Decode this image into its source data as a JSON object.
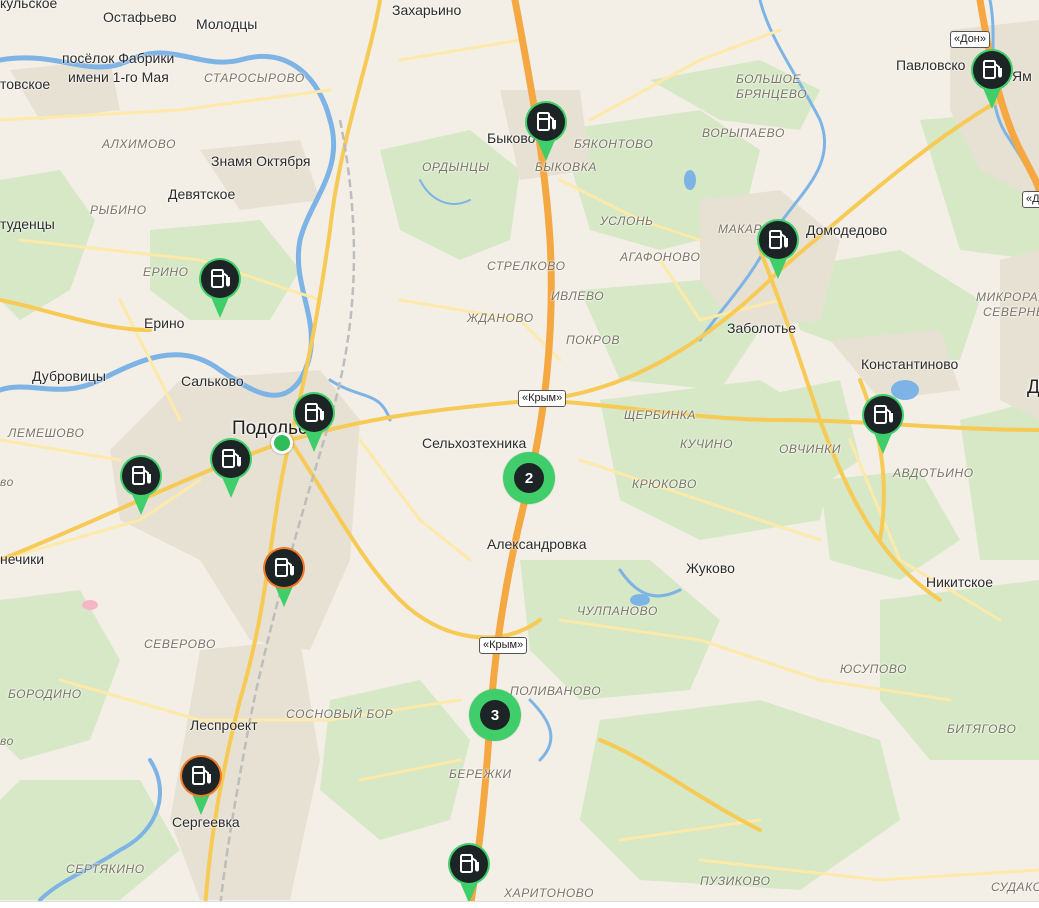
{
  "map": {
    "colors": {
      "background": "#f3efe6",
      "forest": "#d6e8c6",
      "built_up": "#e7e1d3",
      "water": "#7eb3e6",
      "road_minor": "#fde9a8",
      "road_major": "#f7c955",
      "road_highway": "#f5a742",
      "railway": "#bdbdbd",
      "pin_body": "#1d2426",
      "pin_green": "#3fce6a",
      "pin_orange": "#f07b26",
      "cluster_green": "#3fce6a"
    },
    "labels": [
      {
        "text": "Остафьево",
        "style": "town"
      },
      {
        "text": "Молодцы",
        "style": "town"
      },
      {
        "text": "Захарьино",
        "style": "town"
      },
      {
        "text": "кульское",
        "style": "town"
      },
      {
        "text": "посёлок Фабрики",
        "style": "town"
      },
      {
        "text": "имени 1-го Мая",
        "style": "town"
      },
      {
        "text": "СТАРОСЫРОВО",
        "style": "dist"
      },
      {
        "text": "товское",
        "style": "town"
      },
      {
        "text": "АЛХИМОВО",
        "style": "dist"
      },
      {
        "text": "Знамя Октября",
        "style": "town"
      },
      {
        "text": "Девятское",
        "style": "town"
      },
      {
        "text": "РЫБИНО",
        "style": "dist"
      },
      {
        "text": "тудeнцы",
        "style": "town"
      },
      {
        "text": "ЕРИНО",
        "style": "dist"
      },
      {
        "text": "Ерино",
        "style": "town"
      },
      {
        "text": "Сальково",
        "style": "town"
      },
      {
        "text": "Дубровицы",
        "style": "town"
      },
      {
        "text": "ЛЕМЕШОВО",
        "style": "dist"
      },
      {
        "text": "Подольск",
        "style": "city"
      },
      {
        "text": "во",
        "style": "dist"
      },
      {
        "text": "нечики",
        "style": "town"
      },
      {
        "text": "СЕВЕРОВО",
        "style": "dist"
      },
      {
        "text": "БОРОДИНО",
        "style": "dist"
      },
      {
        "text": "Леспроект",
        "style": "town"
      },
      {
        "text": "СОСНОВЫЙ БОР",
        "style": "dist"
      },
      {
        "text": "во",
        "style": "dist"
      },
      {
        "text": "Сергеевка",
        "style": "town"
      },
      {
        "text": "СЕРТЯКИНО",
        "style": "dist"
      },
      {
        "text": "Быково",
        "style": "town"
      },
      {
        "text": "БЫКОВКА",
        "style": "dist"
      },
      {
        "text": "БЯКОНТОВО",
        "style": "dist"
      },
      {
        "text": "ОРДЫНЦЫ",
        "style": "dist"
      },
      {
        "text": "БОЛЬШОЕ",
        "style": "dist"
      },
      {
        "text": "БРЯНЦЕВО",
        "style": "dist"
      },
      {
        "text": "ВОРЫПАЕВО",
        "style": "dist"
      },
      {
        "text": "УСЛОНЬ",
        "style": "dist"
      },
      {
        "text": "АГАФОНОВО",
        "style": "dist"
      },
      {
        "text": "СТРЕЛКОВО",
        "style": "dist"
      },
      {
        "text": "ИВЛЕВО",
        "style": "dist"
      },
      {
        "text": "ЖДАНОВО",
        "style": "dist"
      },
      {
        "text": "ПОКРОВ",
        "style": "dist"
      },
      {
        "text": "Сельхозтехника",
        "style": "town"
      },
      {
        "text": "ЩЕРБИНКА",
        "style": "dist"
      },
      {
        "text": "КУЧИНО",
        "style": "dist"
      },
      {
        "text": "КРЮКОВО",
        "style": "dist"
      },
      {
        "text": "Александровка",
        "style": "town"
      },
      {
        "text": "Жуково",
        "style": "town"
      },
      {
        "text": "ЧУЛПАНОВО",
        "style": "dist"
      },
      {
        "text": "ПОЛИВАНОВО",
        "style": "dist"
      },
      {
        "text": "БЕРЕЖКИ",
        "style": "dist"
      },
      {
        "text": "ХАРИТОНОВО",
        "style": "dist"
      },
      {
        "text": "ПУЗИКОВО",
        "style": "dist"
      },
      {
        "text": "МАКАР",
        "style": "dist"
      },
      {
        "text": "Домодедово",
        "style": "town"
      },
      {
        "text": "Заболотье",
        "style": "town"
      },
      {
        "text": "Павловско",
        "style": "town"
      },
      {
        "text": "Ям",
        "style": "town"
      },
      {
        "text": "МИКРОРАЙ",
        "style": "dist"
      },
      {
        "text": "СЕВЕРНЫ",
        "style": "dist"
      },
      {
        "text": "Константиново",
        "style": "town"
      },
      {
        "text": "Д",
        "style": "city"
      },
      {
        "text": "ОВЧИНКИ",
        "style": "dist"
      },
      {
        "text": "АВДОТЬИНО",
        "style": "dist"
      },
      {
        "text": "Никитское",
        "style": "town"
      },
      {
        "text": "ЮСУПОВО",
        "style": "dist"
      },
      {
        "text": "БИТЯГОВО",
        "style": "dist"
      },
      {
        "text": "СУДАКОВ",
        "style": "dist"
      }
    ],
    "shields": [
      "«Крым»",
      "«Крым»",
      "«Дон»",
      "«Дон»"
    ],
    "markers": [
      {
        "name": "fuel-station-marker-yerino",
        "accent": "green"
      },
      {
        "name": "fuel-station-marker-bykovo",
        "accent": "green"
      },
      {
        "name": "fuel-station-marker-domodedovo",
        "accent": "green"
      },
      {
        "name": "fuel-station-marker-pavlovskoe",
        "accent": "green"
      },
      {
        "name": "fuel-station-marker-podolsk-north",
        "accent": "green"
      },
      {
        "name": "fuel-station-marker-podolsk-center",
        "accent": "green"
      },
      {
        "name": "fuel-station-marker-podolsk-west",
        "accent": "green"
      },
      {
        "name": "fuel-station-marker-podolsk-south",
        "accent": "orange"
      },
      {
        "name": "fuel-station-marker-konstantinovo",
        "accent": "green"
      },
      {
        "name": "fuel-station-marker-sergeevka",
        "accent": "orange"
      },
      {
        "name": "fuel-station-marker-kharitonovo",
        "accent": "green"
      }
    ],
    "clusters": [
      {
        "name": "fuel-station-cluster-aleksandrovka",
        "count": "2"
      },
      {
        "name": "fuel-station-cluster-polivanovo",
        "count": "3"
      }
    ],
    "icons": {
      "marker": "fuel-pump-icon",
      "user": "current-location-icon"
    }
  }
}
